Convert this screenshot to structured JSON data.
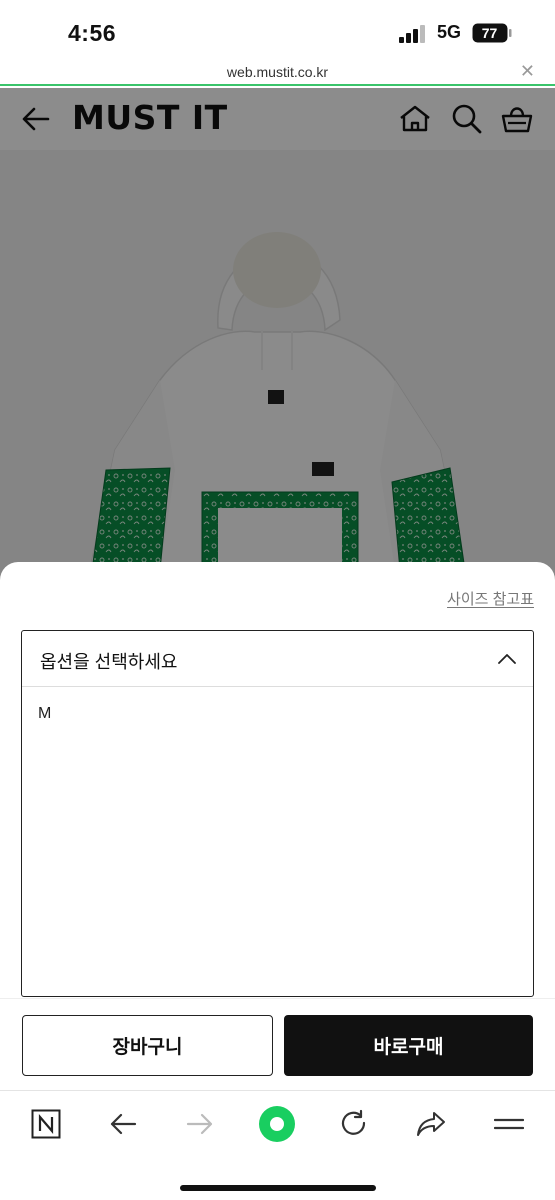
{
  "status_bar": {
    "time": "4:56",
    "network": "5G",
    "battery": "77"
  },
  "url_bar": {
    "url": "web.mustit.co.kr",
    "close_icon": "close-icon",
    "accent_color": "#3ac46b"
  },
  "header": {
    "logo": "MUST IT",
    "icons": [
      "back-arrow-icon",
      "home-icon",
      "search-icon",
      "basket-icon"
    ]
  },
  "option_sheet": {
    "size_chart_link": "사이즈 참고표",
    "select_label": "옵션을 선택하세요",
    "options": [
      "M"
    ]
  },
  "actions": {
    "cart_label": "장바구니",
    "buy_label": "바로구매"
  },
  "browser_toolbar": {
    "icons": [
      "naver-n-icon",
      "back-icon",
      "forward-icon",
      "green-dot-icon",
      "refresh-icon",
      "share-icon",
      "menu-icon"
    ],
    "accent_color": "#19ce60"
  }
}
